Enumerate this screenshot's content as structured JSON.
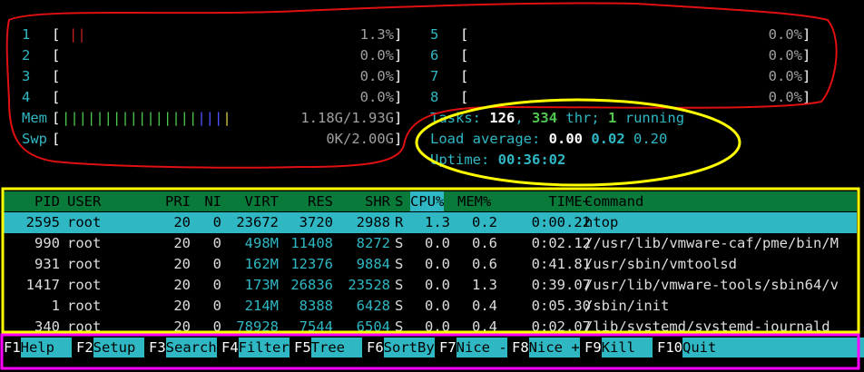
{
  "cpus": [
    {
      "label": "1",
      "bars": "||",
      "value": "1.3%"
    },
    {
      "label": "2",
      "bars": "",
      "value": "0.0%"
    },
    {
      "label": "3",
      "bars": "",
      "value": "0.0%"
    },
    {
      "label": "4",
      "bars": "",
      "value": "0.0%"
    },
    {
      "label": "5",
      "bars": "",
      "value": "0.0%"
    },
    {
      "label": "6",
      "bars": "",
      "value": "0.0%"
    },
    {
      "label": "7",
      "bars": "",
      "value": "0.0%"
    },
    {
      "label": "8",
      "bars": "",
      "value": "0.0%"
    }
  ],
  "mem": {
    "label": "Mem",
    "bars_green": "||||||||||||||||",
    "bars_blue": "|||",
    "bars_yellow": "|",
    "value": "1.18G/1.93G"
  },
  "swp": {
    "label": "Swp",
    "value": "0K/2.00G"
  },
  "tasks": {
    "label": "Tasks:",
    "count": "126",
    "sep": ",",
    "threads": "334",
    "thr_label": "thr;",
    "running": "1",
    "running_label": "running"
  },
  "load": {
    "label": "Load average:",
    "v1": "0.00",
    "v5": "0.02",
    "v15": "0.20"
  },
  "uptime": {
    "label": "Uptime:",
    "value": "00:36:02"
  },
  "table": {
    "headers": {
      "pid": "PID",
      "user": "USER",
      "pri": "PRI",
      "ni": "NI",
      "virt": "VIRT",
      "res": "RES",
      "shr": "SHR",
      "s": "S",
      "cpu": "CPU%",
      "mem": "MEM%",
      "time": "TIME+",
      "cmd": "Command"
    },
    "rows": [
      {
        "pid": "2595",
        "user": "root",
        "pri": "20",
        "ni": "0",
        "virt": "23672",
        "res": "3720",
        "shr": "2988",
        "s": "R",
        "cpu": "1.3",
        "mem": "0.2",
        "time": "0:00.22",
        "cmd": "htop"
      },
      {
        "pid": "990",
        "user": "root",
        "pri": "20",
        "ni": "0",
        "virt": "498M",
        "res": "11408",
        "shr": "8272",
        "s": "S",
        "cpu": "0.0",
        "mem": "0.6",
        "time": "0:02.12",
        "cmd": "//usr/lib/vmware-caf/pme/bin/M"
      },
      {
        "pid": "931",
        "user": "root",
        "pri": "20",
        "ni": "0",
        "virt": "162M",
        "res": "12376",
        "shr": "9884",
        "s": "S",
        "cpu": "0.0",
        "mem": "0.6",
        "time": "0:41.81",
        "cmd": "/usr/sbin/vmtoolsd"
      },
      {
        "pid": "1417",
        "user": "root",
        "pri": "20",
        "ni": "0",
        "virt": "173M",
        "res": "26836",
        "shr": "23528",
        "s": "S",
        "cpu": "0.0",
        "mem": "1.3",
        "time": "0:39.07",
        "cmd": "/usr/lib/vmware-tools/sbin64/v"
      },
      {
        "pid": "1",
        "user": "root",
        "pri": "20",
        "ni": "0",
        "virt": "214M",
        "res": "8388",
        "shr": "6428",
        "s": "S",
        "cpu": "0.0",
        "mem": "0.4",
        "time": "0:05.30",
        "cmd": "/sbin/init"
      },
      {
        "pid": "340",
        "user": "root",
        "pri": "20",
        "ni": "0",
        "virt": "78928",
        "res": "7544",
        "shr": "6504",
        "s": "S",
        "cpu": "0.0",
        "mem": "0.4",
        "time": "0:02.07",
        "cmd": "/lib/systemd/systemd-journald"
      }
    ]
  },
  "fkeys": [
    {
      "key": "F1",
      "label": "Help  "
    },
    {
      "key": "F2",
      "label": "Setup "
    },
    {
      "key": "F3",
      "label": "Search"
    },
    {
      "key": "F4",
      "label": "Filter"
    },
    {
      "key": "F5",
      "label": "Tree  "
    },
    {
      "key": "F6",
      "label": "SortBy"
    },
    {
      "key": "F7",
      "label": "Nice -"
    },
    {
      "key": "F8",
      "label": "Nice +"
    },
    {
      "key": "F9",
      "label": "Kill  "
    },
    {
      "key": "F10",
      "label": "Quit  "
    }
  ],
  "colors": {
    "red_annotation": "#e01010",
    "yellow_annotation": "#ffff00",
    "magenta_annotation": "#ff00ff",
    "cyan": "#2fb8c4",
    "header_green": "#0a7a3a"
  }
}
